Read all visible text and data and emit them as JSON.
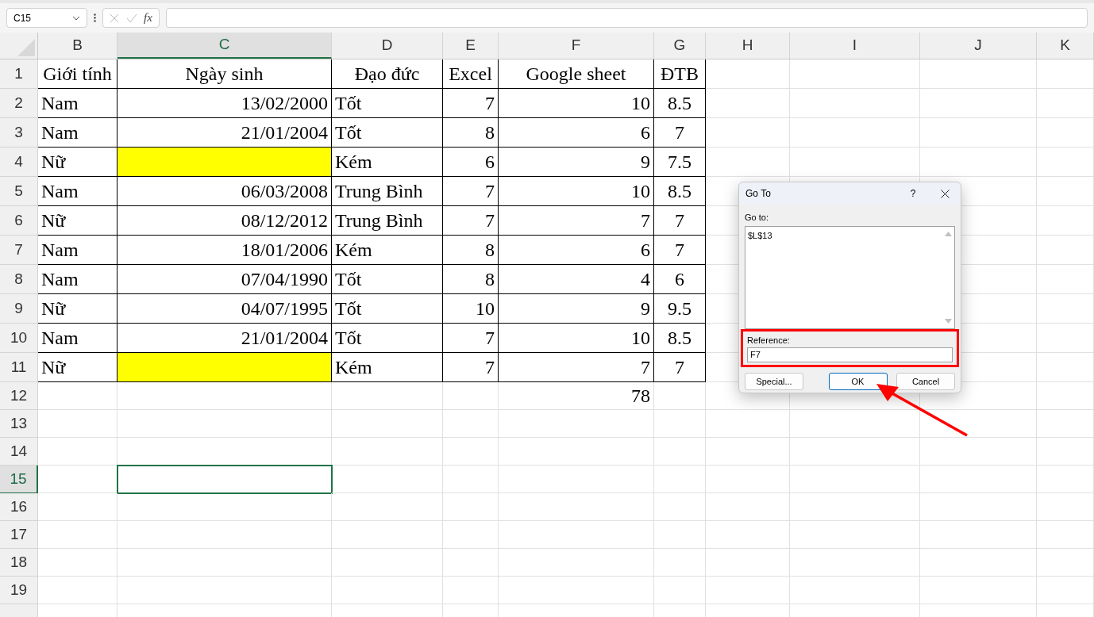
{
  "formula_bar": {
    "name_box": "C15",
    "function_label": "fx"
  },
  "columns": [
    {
      "label": "B",
      "selected": false
    },
    {
      "label": "C",
      "selected": true
    },
    {
      "label": "D",
      "selected": false
    },
    {
      "label": "E",
      "selected": false
    },
    {
      "label": "F",
      "selected": false
    },
    {
      "label": "G",
      "selected": false
    },
    {
      "label": "H",
      "selected": false
    },
    {
      "label": "I",
      "selected": false
    },
    {
      "label": "J",
      "selected": false
    },
    {
      "label": "K",
      "selected": false
    }
  ],
  "rows": [
    {
      "label": "1",
      "selected": false,
      "kind": "header",
      "cells": [
        {
          "text": "Giới tính"
        },
        {
          "text": "Ngày sinh"
        },
        {
          "text": "Đạo đức"
        },
        {
          "text": "Excel"
        },
        {
          "text": "Google sheet"
        },
        {
          "text": "ĐTB"
        }
      ]
    },
    {
      "label": "2",
      "selected": false,
      "kind": "data",
      "cells": [
        {
          "text": "Nam"
        },
        {
          "text": "13/02/2000"
        },
        {
          "text": "Tốt"
        },
        {
          "text": "7"
        },
        {
          "text": "10"
        },
        {
          "text": "8.5"
        }
      ]
    },
    {
      "label": "3",
      "selected": false,
      "kind": "data",
      "cells": [
        {
          "text": "Nam"
        },
        {
          "text": "21/01/2004"
        },
        {
          "text": "Tốt"
        },
        {
          "text": "8"
        },
        {
          "text": "6"
        },
        {
          "text": "7"
        }
      ]
    },
    {
      "label": "4",
      "selected": false,
      "kind": "data",
      "cells": [
        {
          "text": "Nữ"
        },
        {
          "color": "#ffff00"
        },
        {
          "text": "Kém"
        },
        {
          "text": "6"
        },
        {
          "text": "9"
        },
        {
          "text": "7.5"
        }
      ]
    },
    {
      "label": "5",
      "selected": false,
      "kind": "data",
      "cells": [
        {
          "text": "Nam"
        },
        {
          "text": "06/03/2008"
        },
        {
          "text": "Trung Bình"
        },
        {
          "text": "7"
        },
        {
          "text": "10"
        },
        {
          "text": "8.5"
        }
      ]
    },
    {
      "label": "6",
      "selected": false,
      "kind": "data",
      "cells": [
        {
          "text": "Nữ"
        },
        {
          "text": "08/12/2012"
        },
        {
          "text": "Trung Bình"
        },
        {
          "text": "7"
        },
        {
          "text": "7"
        },
        {
          "text": "7"
        }
      ]
    },
    {
      "label": "7",
      "selected": false,
      "kind": "data",
      "cells": [
        {
          "text": "Nam"
        },
        {
          "text": "18/01/2006"
        },
        {
          "text": "Kém"
        },
        {
          "text": "8"
        },
        {
          "text": "6"
        },
        {
          "text": "7"
        }
      ]
    },
    {
      "label": "8",
      "selected": false,
      "kind": "data",
      "cells": [
        {
          "text": "Nam"
        },
        {
          "text": "07/04/1990"
        },
        {
          "text": "Tốt"
        },
        {
          "text": "8"
        },
        {
          "text": "4"
        },
        {
          "text": "6"
        }
      ]
    },
    {
      "label": "9",
      "selected": false,
      "kind": "data",
      "cells": [
        {
          "text": "Nữ"
        },
        {
          "text": "04/07/1995"
        },
        {
          "text": "Tốt"
        },
        {
          "text": "10"
        },
        {
          "text": "9"
        },
        {
          "text": "9.5"
        }
      ]
    },
    {
      "label": "10",
      "selected": false,
      "kind": "data",
      "cells": [
        {
          "text": "Nam"
        },
        {
          "text": "21/01/2004"
        },
        {
          "text": "Tốt"
        },
        {
          "text": "7"
        },
        {
          "text": "10"
        },
        {
          "text": "8.5"
        }
      ]
    },
    {
      "label": "11",
      "selected": false,
      "kind": "data",
      "cells": [
        {
          "text": "Nữ"
        },
        {
          "color": "#ffff00"
        },
        {
          "text": "Kém"
        },
        {
          "text": "7"
        },
        {
          "text": "7"
        },
        {
          "text": "7"
        }
      ]
    },
    {
      "label": "12",
      "selected": false,
      "kind": "plain",
      "cells": [
        {},
        {},
        {},
        {},
        {
          "text": "78"
        }
      ]
    },
    {
      "label": "13",
      "selected": false,
      "kind": "plain",
      "cells": []
    },
    {
      "label": "14",
      "selected": false,
      "kind": "plain",
      "cells": []
    },
    {
      "label": "15",
      "selected": true,
      "kind": "plain",
      "cells": []
    },
    {
      "label": "16",
      "selected": false,
      "kind": "plain",
      "cells": []
    },
    {
      "label": "17",
      "selected": false,
      "kind": "plain",
      "cells": []
    },
    {
      "label": "18",
      "selected": false,
      "kind": "plain",
      "cells": []
    },
    {
      "label": "19",
      "selected": false,
      "kind": "plain",
      "cells": []
    }
  ],
  "dialog": {
    "title": "Go To",
    "help": "?",
    "goto_label": "Go to:",
    "goto_items": [
      "$L$13"
    ],
    "reference_label": "Reference:",
    "reference_value": "F7",
    "buttons": [
      {
        "label": "Special...",
        "selected": false
      },
      {
        "label": "OK",
        "selected": true
      },
      {
        "label": "Cancel",
        "selected": false
      }
    ]
  }
}
